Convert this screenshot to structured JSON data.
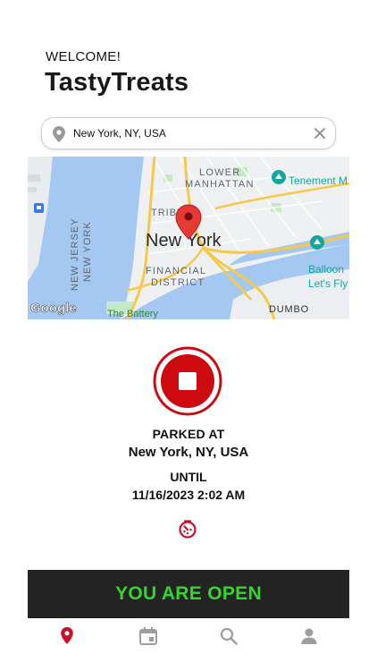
{
  "header": {
    "welcome": "WELCOME!",
    "brand": "TastyTreats"
  },
  "search": {
    "value": "New York, NY, USA",
    "icon": "location-pin-icon",
    "clear_icon": "close-icon"
  },
  "map": {
    "labels": {
      "lower": "LOWER",
      "manhattan": "MANHATTAN",
      "tribeca": "TRIBE",
      "city": "New York",
      "financial": "FINANCIAL",
      "district": "DISTRICT",
      "new_jersey": "NEW JERSEY",
      "new_york_state": "NEW YORK",
      "battery": "The Battery",
      "dumbo": "DUMBO",
      "tenement": "Tenement M",
      "balloon": "Balloon",
      "lets_fly": "Let's Fly",
      "google": "Google"
    }
  },
  "status": {
    "parked_label": "PARKED AT",
    "parked_location": "New York, NY, USA",
    "until_label": "UNTIL",
    "until_time": "11/16/2023 2:02 AM"
  },
  "open_banner": {
    "label": "YOU ARE OPEN",
    "color": "#37d430"
  },
  "colors": {
    "accent": "#c8102e",
    "stop_red": "#cc0a10",
    "bar": "#232323",
    "tab_inactive": "#9e9e9e"
  },
  "tabs": [
    {
      "name": "map",
      "icon": "location-pin-icon",
      "active": true
    },
    {
      "name": "calendar",
      "icon": "calendar-icon",
      "active": false
    },
    {
      "name": "search",
      "icon": "search-icon",
      "active": false
    },
    {
      "name": "profile",
      "icon": "person-icon",
      "active": false
    }
  ]
}
